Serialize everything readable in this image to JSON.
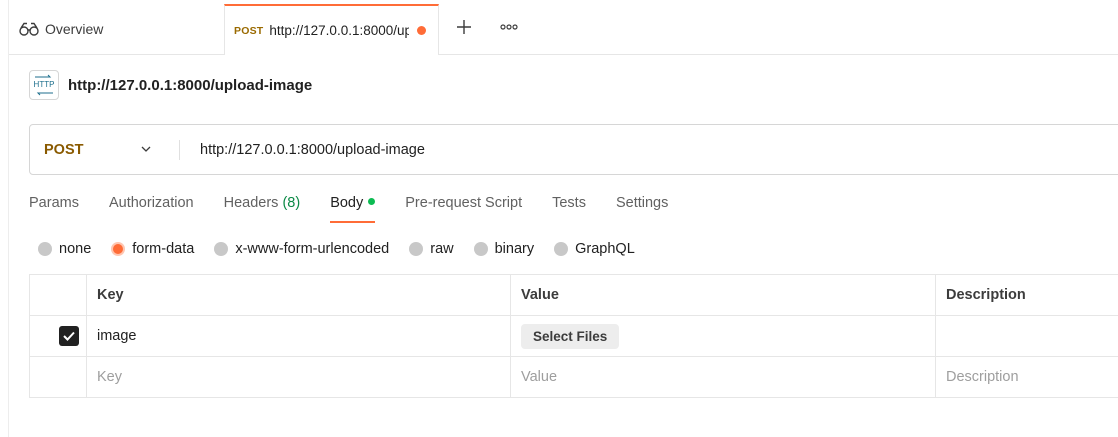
{
  "tabs": {
    "overview_label": "Overview",
    "active": {
      "method": "POST",
      "url": "http://127.0.0.1:8000/upload-image"
    }
  },
  "request": {
    "title": "http://127.0.0.1:8000/upload-image",
    "icon_text": "HTTP",
    "method": "POST",
    "url": "http://127.0.0.1:8000/upload-image"
  },
  "req_tabs": {
    "params": "Params",
    "authorization": "Authorization",
    "headers": "Headers",
    "headers_count": "(8)",
    "body": "Body",
    "prerequest": "Pre-request Script",
    "tests": "Tests",
    "settings": "Settings"
  },
  "body_types": {
    "none": "none",
    "form_data": "form-data",
    "urlencoded": "x-www-form-urlencoded",
    "raw": "raw",
    "binary": "binary",
    "graphql": "GraphQL",
    "selected": "form-data"
  },
  "table": {
    "headers": {
      "key": "Key",
      "value": "Value",
      "description": "Description"
    },
    "rows": [
      {
        "checked": true,
        "key": "image",
        "value_button": "Select Files",
        "description": ""
      }
    ],
    "placeholders": {
      "key": "Key",
      "value": "Value",
      "description": "Description"
    }
  },
  "colors": {
    "accent": "#ff6c37",
    "method_post": "#8a5a00",
    "status_green": "#0cbb52",
    "count_green": "#0b8a46"
  },
  "icons": [
    "overview-icon",
    "plus-icon",
    "more-icon",
    "http-request-icon",
    "chevron-down-icon",
    "check-icon"
  ]
}
